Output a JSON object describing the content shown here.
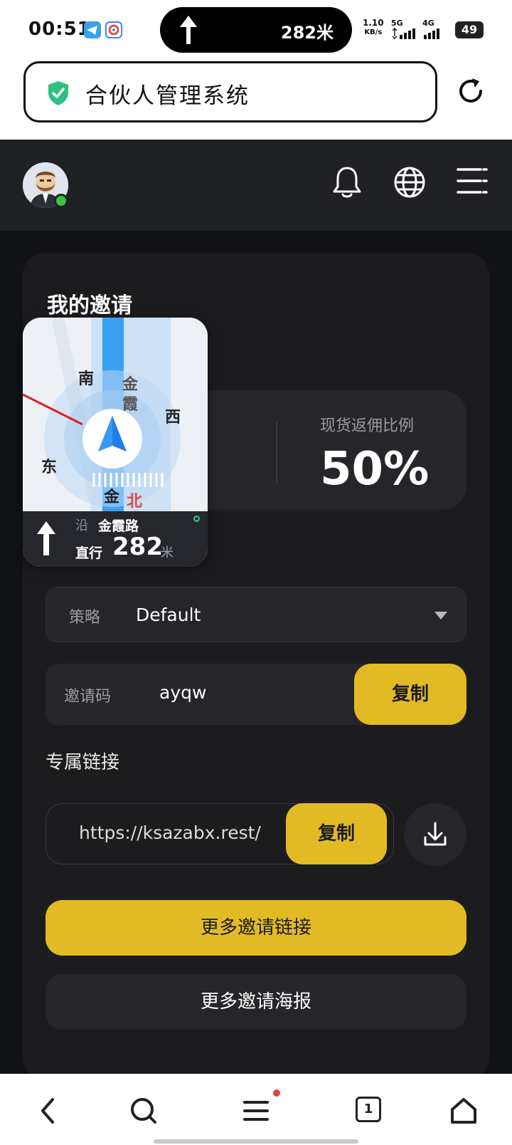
{
  "status_bar": {
    "time": "00:51",
    "nav_distance": "282米",
    "net_speed_value": "1.10",
    "net_speed_unit": "KB/s",
    "sim1": "5G",
    "sim2": "4G",
    "battery": "49"
  },
  "browser": {
    "site_title": "合伙人管理系统",
    "icons": [
      "shield-check-icon",
      "refresh-icon"
    ]
  },
  "app_header": {
    "icons": [
      "bell-icon",
      "globe-icon",
      "menu-icon"
    ]
  },
  "invite": {
    "title": "我的邀请",
    "stat_label": "现货返佣比例",
    "stat_value": "50%",
    "strategy_label": "策略",
    "strategy_value": "Default",
    "code_label": "邀请码",
    "code_value": "ayqw",
    "copy_label": "复制",
    "link_section_label": "专属链接",
    "link_value": "https://ksazabx.rest/",
    "more_links": "更多邀请链接",
    "more_posters": "更多邀请海报"
  },
  "nav_widget": {
    "map_labels": {
      "south": "南",
      "west": "西",
      "east": "东",
      "north": "北",
      "road_char_1": "金",
      "road_char_2": "霞",
      "road_char_3": "金"
    },
    "along": "沿",
    "road": "金霞路",
    "action": "直行",
    "distance": "282",
    "unit": "米"
  },
  "bottom_bar": {
    "tab_count": "1",
    "icons": [
      "back-icon",
      "search-icon",
      "menu-icon",
      "tabs-icon",
      "home-icon"
    ]
  }
}
